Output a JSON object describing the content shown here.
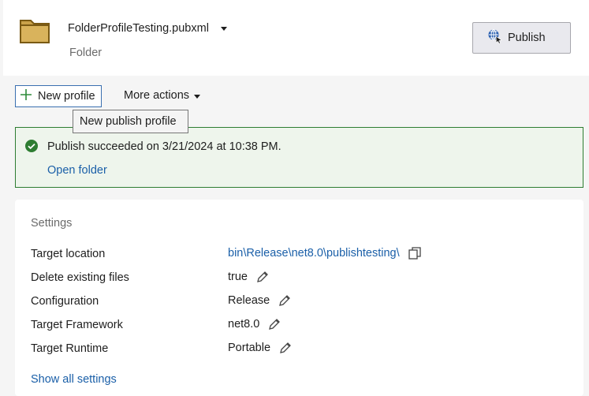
{
  "header": {
    "profile_name": "FolderProfileTesting.pubxml",
    "profile_type": "Folder",
    "publish_label": "Publish"
  },
  "toolbar": {
    "new_profile_label": "New profile",
    "more_actions_label": "More actions",
    "tooltip": "New publish profile"
  },
  "status": {
    "message": "Publish succeeded on 3/21/2024 at 10:38 PM.",
    "open_folder_label": "Open folder"
  },
  "settings": {
    "title": "Settings",
    "rows": [
      {
        "label": "Target location",
        "value": "bin\\Release\\net8.0\\publishtesting\\"
      },
      {
        "label": "Delete existing files",
        "value": "true"
      },
      {
        "label": "Configuration",
        "value": "Release"
      },
      {
        "label": "Target Framework",
        "value": "net8.0"
      },
      {
        "label": "Target Runtime",
        "value": "Portable"
      }
    ],
    "show_all_label": "Show all settings"
  },
  "icons": {
    "folder": "folder-icon",
    "publish": "globe-publish-icon",
    "new_profile": "plus-icon",
    "success": "check-circle-icon",
    "copy": "copy-icon",
    "edit": "pencil-icon"
  },
  "colors": {
    "link": "#1a5fa8",
    "success_border": "#2e7d32",
    "success_bg": "#eef5ec",
    "folder_fill": "#c9a24a"
  }
}
